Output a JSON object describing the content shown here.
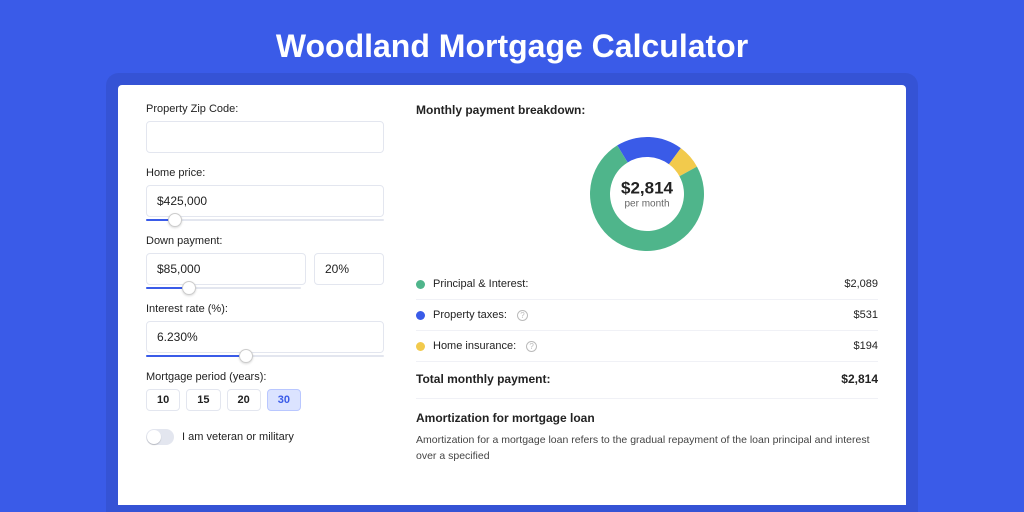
{
  "title": "Woodland Mortgage Calculator",
  "form": {
    "zip": {
      "label": "Property Zip Code:",
      "value": ""
    },
    "home_price": {
      "label": "Home price:",
      "value": "$425,000",
      "slider_pct": 12
    },
    "down": {
      "label": "Down payment:",
      "amount": "$85,000",
      "rate": "20%",
      "slider_pct": 28
    },
    "interest": {
      "label": "Interest rate (%):",
      "value": "6.230%",
      "slider_pct": 42
    },
    "period": {
      "label": "Mortgage period (years):",
      "options": [
        "10",
        "15",
        "20",
        "30"
      ],
      "selected": "30"
    },
    "veteran": {
      "label": "I am veteran or military",
      "on": false
    }
  },
  "breakdown": {
    "title": "Monthly payment breakdown:",
    "center_amount": "$2,814",
    "center_sub": "per month",
    "items": [
      {
        "label": "Principal & Interest:",
        "value": "$2,089",
        "color": "#4fb58b",
        "info": false
      },
      {
        "label": "Property taxes:",
        "value": "$531",
        "color": "#3a5be8",
        "info": true
      },
      {
        "label": "Home insurance:",
        "value": "$194",
        "color": "#f2ca4c",
        "info": true
      }
    ],
    "total_label": "Total monthly payment:",
    "total_value": "$2,814"
  },
  "amort": {
    "title": "Amortization for mortgage loan",
    "text": "Amortization for a mortgage loan refers to the gradual repayment of the loan principal and interest over a specified"
  },
  "chart_data": {
    "type": "pie",
    "title": "Monthly payment breakdown",
    "series": [
      {
        "name": "Principal & Interest",
        "value": 2089,
        "color": "#4fb58b"
      },
      {
        "name": "Property taxes",
        "value": 531,
        "color": "#3a5be8"
      },
      {
        "name": "Home insurance",
        "value": 194,
        "color": "#f2ca4c"
      }
    ],
    "total": 2814,
    "center_label": "$2,814 per month"
  }
}
